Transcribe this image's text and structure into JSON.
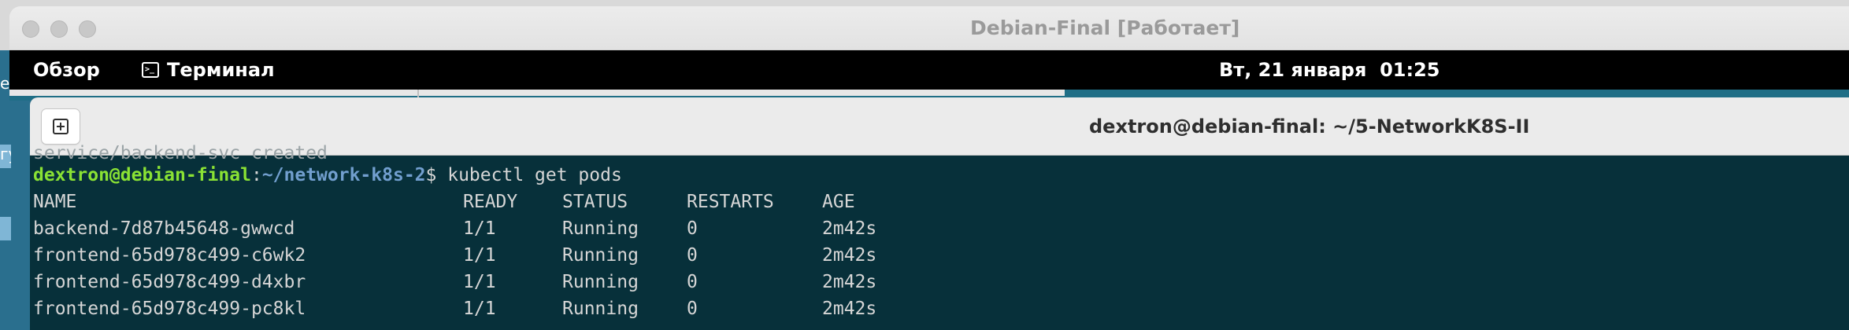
{
  "vm_window": {
    "title": "Debian-Final [Работает]"
  },
  "topbar": {
    "overview_label": "Обзор",
    "app_menu_label": "Терминал",
    "clock": "Вт, 21 января  01:25"
  },
  "desktop": {
    "partial_labels": [
      "ес",
      "гу"
    ]
  },
  "terminal": {
    "window_title": "dextron@debian-final: ~/5-NetworkK8S-II",
    "cut_line": "service/backend-svc created",
    "prompt": {
      "user_host": "dextron@debian-final",
      "sep": ":",
      "path": "~/network-k8s-2",
      "dollar": "$ ",
      "command": "kubectl get pods"
    },
    "table": {
      "headers": [
        "NAME",
        "READY",
        "STATUS",
        "RESTARTS",
        "AGE"
      ],
      "rows": [
        [
          "backend-7d87b45648-gwwcd",
          "1/1",
          "Running",
          "0",
          "2m42s"
        ],
        [
          "frontend-65d978c499-c6wk2",
          "1/1",
          "Running",
          "0",
          "2m42s"
        ],
        [
          "frontend-65d978c499-d4xbr",
          "1/1",
          "Running",
          "0",
          "2m42s"
        ],
        [
          "frontend-65d978c499-pc8kl",
          "1/1",
          "Running",
          "0",
          "2m42s"
        ]
      ]
    }
  }
}
